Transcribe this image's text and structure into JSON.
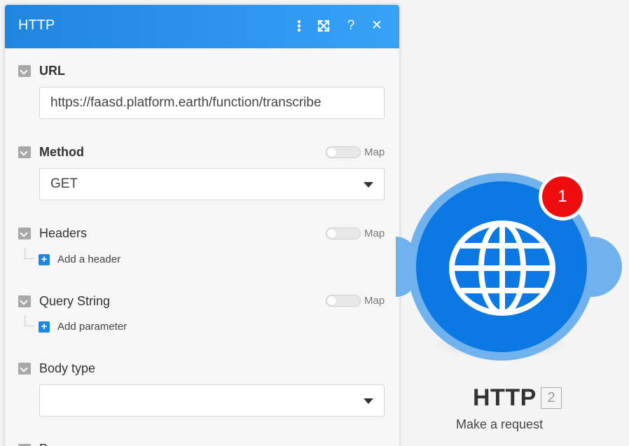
{
  "panel": {
    "title": "HTTP",
    "header_buttons": {
      "menu_icon": "vertical-dots-icon",
      "expand_icon": "expand-arrows-icon",
      "help_label": "?",
      "close_label": "✕"
    },
    "colors": {
      "header_start": "#1f86e0",
      "header_end": "#36a3f6",
      "background": "#f6f6f6"
    }
  },
  "fields": {
    "url": {
      "label": "URL",
      "value": "https://faasd.platform.earth/function/transcribe"
    },
    "method": {
      "label": "Method",
      "value": "GET",
      "map_label": "Map"
    },
    "headers": {
      "label": "Headers",
      "map_label": "Map",
      "add_label": "Add a header"
    },
    "query_string": {
      "label": "Query String",
      "map_label": "Map",
      "add_label": "Add parameter"
    },
    "body_type": {
      "label": "Body type",
      "value": ""
    },
    "next_field_label": "P"
  },
  "module": {
    "name": "HTTP",
    "id": "2",
    "subtitle": "Make a request",
    "badge_count": "1",
    "icon": "globe-icon",
    "colors": {
      "outer": "#6fb2ee",
      "inner": "#0b78e3",
      "badge": "#ee0c0c"
    }
  }
}
